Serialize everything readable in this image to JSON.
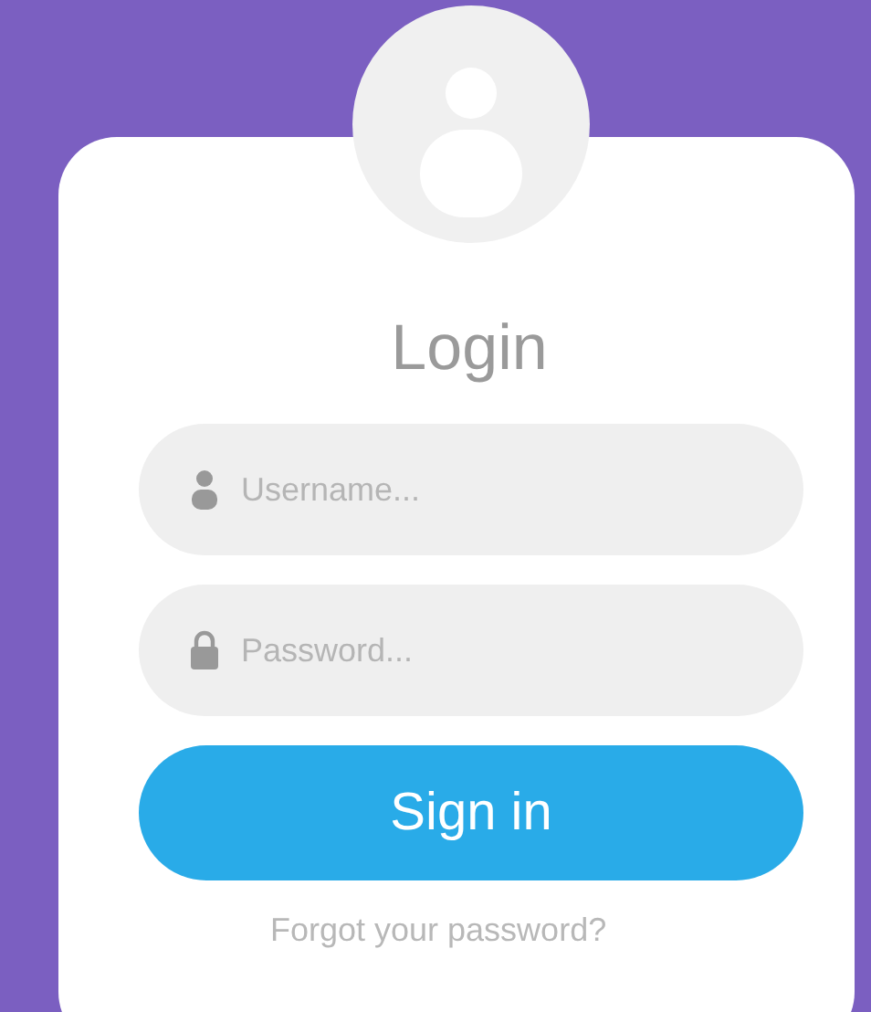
{
  "title": "Login",
  "fields": [
    {
      "kind": "user",
      "placeholder": "Username..."
    },
    {
      "kind": "lock",
      "placeholder": "Password..."
    }
  ],
  "button": "Sign in",
  "link": "Forgot your password?"
}
